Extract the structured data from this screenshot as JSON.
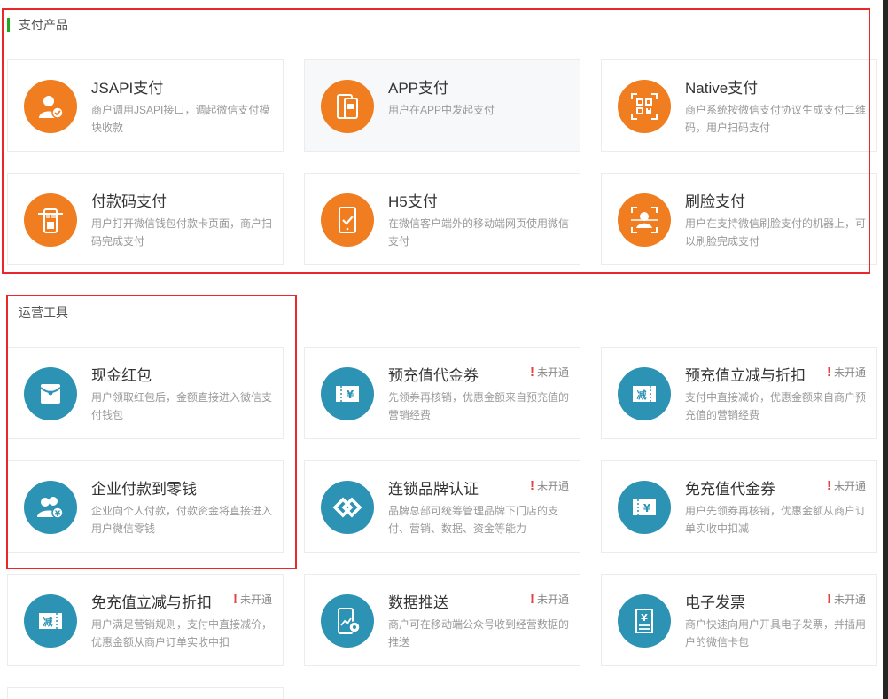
{
  "sections": [
    {
      "title": "支付产品"
    },
    {
      "title": "运营工具"
    }
  ],
  "status_label": "未开通",
  "colors": {
    "orange": "#f07d20",
    "teal": "#2c93b4",
    "accent_green": "#1aad19",
    "alert_red": "#e64340",
    "highlight_red": "#e8282a"
  },
  "payment_products": [
    {
      "name": "JSAPI支付",
      "desc": "商户调用JSAPI接口，调起微信支付模块收款",
      "icon": "user-check-icon"
    },
    {
      "name": "APP支付",
      "desc": "用户在APP中发起支付",
      "icon": "phone-app-icon"
    },
    {
      "name": "Native支付",
      "desc": "商户系统按微信支付协议生成支付二维码，用户扫码支付",
      "icon": "qr-code-icon"
    },
    {
      "name": "付款码支付",
      "desc": "用户打开微信钱包付款卡页面，商户扫码完成支付",
      "icon": "barcode-scanner-icon"
    },
    {
      "name": "H5支付",
      "desc": "在微信客户端外的移动端网页使用微信支付",
      "icon": "phone-check-icon"
    },
    {
      "name": "刷脸支付",
      "desc": "用户在支持微信刷脸支付的机器上，可以刷脸完成支付",
      "icon": "face-scan-icon"
    }
  ],
  "operation_tools": [
    {
      "name": "现金红包",
      "desc": "用户领取红包后，金额直接进入微信支付钱包",
      "icon": "red-envelope-icon",
      "status": ""
    },
    {
      "name": "预充值代金券",
      "desc": "先领券再核销，优惠金额来自预充值的营销经费",
      "icon": "voucher-yen-icon",
      "status": "未开通"
    },
    {
      "name": "预充值立减与折扣",
      "desc": "支付中直接减价，优惠金额来自商户预充值的营销经费",
      "icon": "discount-ticket-icon",
      "status": "未开通"
    },
    {
      "name": "企业付款到零钱",
      "desc": "企业向个人付款，付款资金将直接进入用户微信零钱",
      "icon": "users-yen-icon",
      "status": ""
    },
    {
      "name": "连锁品牌认证",
      "desc": "品牌总部可统筹管理品牌下门店的支付、营销、数据、资金等能力",
      "icon": "chain-link-icon",
      "status": "未开通"
    },
    {
      "name": "免充值代金券",
      "desc": "用户先领券再核销，优惠金额从商户订单实收中扣减",
      "icon": "voucher-yen-icon",
      "status": "未开通"
    },
    {
      "name": "免充值立减与折扣",
      "desc": "用户满足营销规则，支付中直接减价，优惠金额从商户订单实收中扣",
      "icon": "discount-ticket-icon",
      "status": "未开通"
    },
    {
      "name": "数据推送",
      "desc": "商户可在移动端公众号收到经营数据的推送",
      "icon": "phone-chart-icon",
      "status": "未开通"
    },
    {
      "name": "电子发票",
      "desc": "商户快速向用户开具电子发票，并插用户的微信卡包",
      "icon": "invoice-icon",
      "status": "未开通"
    }
  ]
}
